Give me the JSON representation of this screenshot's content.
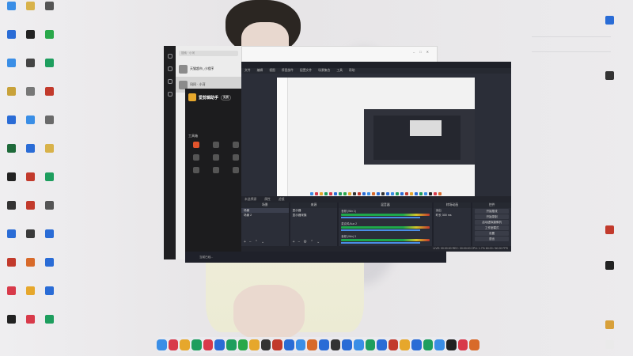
{
  "desktop": {
    "left_icons": [
      {
        "label": "",
        "color": "#3a8ee6"
      },
      {
        "label": "",
        "color": "#d8b24a"
      },
      {
        "label": "",
        "color": "#555"
      },
      {
        "label": "",
        "color": "#2a6cd6"
      },
      {
        "label": "",
        "color": "#222"
      },
      {
        "label": "",
        "color": "#2aa84a"
      },
      {
        "label": "",
        "color": "#3a8ee6"
      },
      {
        "label": "",
        "color": "#444"
      },
      {
        "label": "",
        "color": "#1e9e5e"
      },
      {
        "label": "",
        "color": "#c8a23a"
      },
      {
        "label": "",
        "color": "#777"
      },
      {
        "label": "",
        "color": "#c23a2c"
      },
      {
        "label": "",
        "color": "#2a6cd6"
      },
      {
        "label": "",
        "color": "#3a8ee6"
      },
      {
        "label": "",
        "color": "#6a6a6a"
      },
      {
        "label": "",
        "color": "#1e6a3a"
      },
      {
        "label": "",
        "color": "#2a6cd6"
      },
      {
        "label": "",
        "color": "#d8b24a"
      },
      {
        "label": "",
        "color": "#222"
      },
      {
        "label": "",
        "color": "#c23a2c"
      },
      {
        "label": "",
        "color": "#1e9e5e"
      },
      {
        "label": "",
        "color": "#333"
      },
      {
        "label": "",
        "color": "#c23a2c"
      },
      {
        "label": "",
        "color": "#555"
      },
      {
        "label": "",
        "color": "#2a6cd6"
      },
      {
        "label": "",
        "color": "#3a3a3a"
      },
      {
        "label": "",
        "color": "#2a6cd6"
      },
      {
        "label": "",
        "color": "#c23a2c"
      },
      {
        "label": "",
        "color": "#d86a2a"
      },
      {
        "label": "",
        "color": "#2a6cd6"
      },
      {
        "label": "",
        "color": "#d83a4a"
      },
      {
        "label": "",
        "color": "#e6a72c"
      },
      {
        "label": "",
        "color": "#2a6cd6"
      },
      {
        "label": "",
        "color": "#222"
      },
      {
        "label": "",
        "color": "#d83a4a"
      },
      {
        "label": "",
        "color": "#1e9e5e"
      }
    ],
    "right_icons": [
      {
        "label": "",
        "color": "#2a6cd6"
      },
      {
        "label": "",
        "color": "#333"
      },
      {
        "label": "",
        "color": "#c23a2c"
      },
      {
        "label": "",
        "color": "#222"
      },
      {
        "label": "",
        "color": "#d8a03a"
      },
      {
        "label": "",
        "color": "#eaeaea"
      }
    ]
  },
  "widget": {
    "rows": [
      "",
      "",
      "",
      ""
    ],
    "news": ""
  },
  "chat_app": {
    "search_placeholder": "搜索 · 小河",
    "items": [
      {
        "name": "天猫超市_小程序",
        "sub": "5"
      },
      {
        "name": "讯问 · 小河",
        "sub": ""
      }
    ]
  },
  "dark_app": {
    "brand": "爱剪辑助手",
    "badge": "免费",
    "tabs": [
      "",
      "",
      ""
    ],
    "hint": "",
    "section": "工具箱",
    "tools": [
      {
        "label": "",
        "hot": true
      },
      {
        "label": "",
        "hot": false
      },
      {
        "label": "",
        "hot": false
      },
      {
        "label": "",
        "hot": false
      },
      {
        "label": "",
        "hot": false
      },
      {
        "label": "",
        "hot": false
      },
      {
        "label": "",
        "hot": false
      },
      {
        "label": "",
        "hot": false
      },
      {
        "label": "",
        "hot": false
      }
    ]
  },
  "obs": {
    "title": "",
    "menu": [
      "文件",
      "编辑",
      "视图",
      "停靠部件",
      "配置文件",
      "场景集合",
      "工具",
      "帮助"
    ],
    "second_title": "",
    "bar_items": [
      "未选择源",
      "属性",
      "滤镜"
    ],
    "panels": {
      "scenes": {
        "title": "场景",
        "rows": [
          "场景",
          "场景 2"
        ]
      },
      "sources": {
        "title": "来源",
        "rows": [
          "显示器",
          "显示器采集"
        ]
      },
      "mixer": {
        "title": "混音器",
        "channels": [
          "音频 (Win 1)",
          "麦克风/Aux 2",
          "音频 (Win) 3"
        ]
      },
      "transitions": {
        "title": "转场动画",
        "rows": [
          "淡出",
          "时长 300 ms"
        ]
      },
      "controls": {
        "title": "控件",
        "buttons": [
          "开始推流",
          "开始录制",
          "启动虚拟摄像机",
          "工作室模式",
          "设置",
          "退出"
        ]
      }
    },
    "status": "LIVE: 00:00:00   REC: 00:00:00   CPU: 1.7%   60.00 / 60.00 FPS"
  },
  "strip": {
    "items": [
      "当前已经...",
      "",
      "",
      ""
    ]
  },
  "dock": {
    "icons": [
      "#3a8ee6",
      "#d83a4a",
      "#e6a72c",
      "#1e9e5e",
      "#d83a4a",
      "#2a6cd6",
      "#1e9e5e",
      "#2aa84a",
      "#e6a72c",
      "#333",
      "#c23a2c",
      "#2a6cd6",
      "#3a8ee6",
      "#d86a2a",
      "#2a6cd6",
      "#333",
      "#2a6cd6",
      "#3a8ee6",
      "#1e9e5e",
      "#2a6cd6",
      "#c23a2c",
      "#e6a72c",
      "#2a6cd6",
      "#1e9e5e",
      "#3a8ee6",
      "#222",
      "#d83a4a",
      "#d86a2a"
    ]
  }
}
